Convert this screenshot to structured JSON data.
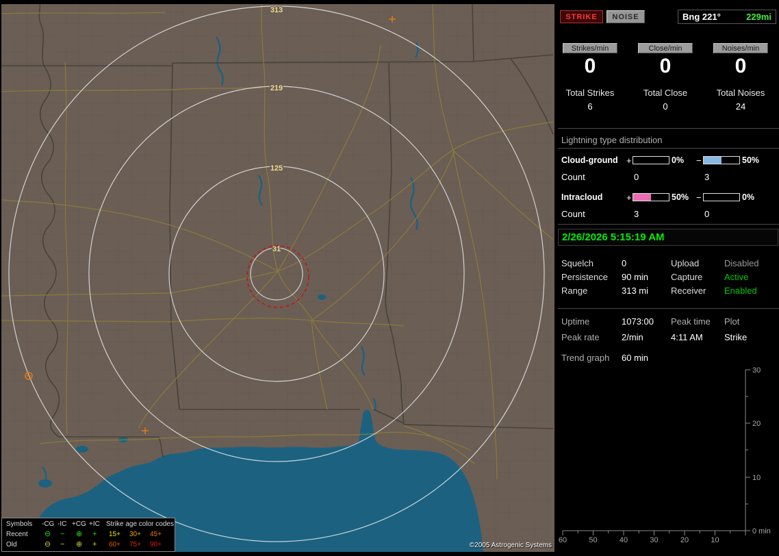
{
  "map": {
    "ring_labels": {
      "r313": "313",
      "r219": "219",
      "r125": "125",
      "r31": "31"
    },
    "copyright": "©2005 Astrogenic Systems",
    "colors": {
      "land": "#6b5e55",
      "water": "#1c6280",
      "border": "#46413a",
      "road": "#8e7f36",
      "ring": "#e8e8e8",
      "ring_label": "#ecd98e",
      "alarm": "#cc1111",
      "strike_old": "#e07818"
    }
  },
  "legend": {
    "symbols_header": "Symbols",
    "columns": [
      "-CG",
      "-IC",
      "+CG",
      "+IC"
    ],
    "age_header": "Strike age color codes",
    "recent_label": "Recent",
    "old_label": "Old",
    "recent_color": "#22dd22",
    "old_color": "#cccc33",
    "symbols": {
      "cg_neg": "⊖",
      "ic_neg": "−",
      "cg_pos": "⊕",
      "ic_pos": "+"
    },
    "ages": [
      {
        "label": "15+",
        "color": "#e8e800"
      },
      {
        "label": "30+",
        "color": "#e8a800"
      },
      {
        "label": "45+",
        "color": "#e87800"
      },
      {
        "label": "60+",
        "color": "#e85400"
      },
      {
        "label": "75+",
        "color": "#e82800"
      },
      {
        "label": "90+",
        "color": "#dd1111"
      }
    ]
  },
  "header": {
    "strike_button": "STRIKE",
    "noise_button": "NOISE",
    "bearing": "Bng 221°",
    "distance": "229mi",
    "distance_color": "#44ee44"
  },
  "counters": [
    {
      "label": "Strikes/min",
      "rate": "0",
      "total_label": "Total Strikes",
      "total": "6"
    },
    {
      "label": "Close/min",
      "rate": "0",
      "total_label": "Total Close",
      "total": "0"
    },
    {
      "label": "Noises/min",
      "rate": "0",
      "total_label": "Total Noises",
      "total": "24"
    }
  ],
  "distribution": {
    "title": "Lightning type distribution",
    "plus": "+",
    "minus": "−",
    "count_label": "Count",
    "rows": [
      {
        "label": "Cloud-ground",
        "pos_pct": "0%",
        "pos_fill": "0%",
        "neg_pct": "50%",
        "neg_fill": "50%",
        "fill_color": "#86b9e6",
        "pos_count": "0",
        "neg_count": "3"
      },
      {
        "label": "Intracloud",
        "pos_pct": "50%",
        "pos_fill": "50%",
        "neg_pct": "0%",
        "neg_fill": "0%",
        "fill_color": "#ec6cb4",
        "pos_count": "3",
        "neg_count": "0"
      }
    ]
  },
  "status": {
    "datetime": "2/26/2026 5:15:19 AM",
    "datetime_color": "#00ee00",
    "rows": [
      {
        "label1": "Squelch",
        "value1": "0",
        "label2": "Upload",
        "value2": "Disabled",
        "value2_color": "#9a9a9a"
      },
      {
        "label1": "Persistence",
        "value1": "90 min",
        "label2": "Capture",
        "value2": "Active",
        "value2_color": "#00cc00"
      },
      {
        "label1": "Range",
        "value1": "313 mi",
        "label2": "Receiver",
        "value2": "Enabled",
        "value2_color": "#00cc00"
      }
    ]
  },
  "stats": {
    "uptime_label": "Uptime",
    "uptime": "1073:00",
    "peak_time_label": "Peak time",
    "peak_time": "4:11 AM",
    "plot_label": "Plot",
    "plot": "Strike",
    "peak_rate_label": "Peak rate",
    "peak_rate": "2/min",
    "trend_label": "Trend graph",
    "trend_window": "60 min"
  },
  "trend_graph": {
    "x_ticks": [
      "60",
      "50",
      "40",
      "30",
      "20",
      "10"
    ],
    "origin_label": "0 min",
    "y_ticks": [
      "30",
      "20",
      "10"
    ]
  }
}
